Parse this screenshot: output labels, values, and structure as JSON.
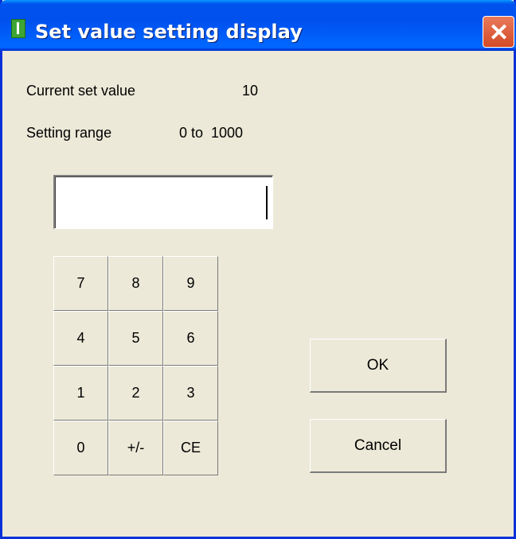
{
  "window": {
    "title": "Set value setting display"
  },
  "info": {
    "current_label": "Current set value",
    "current_value": "10",
    "range_label": "Setting range",
    "range_value": "0 to  1000"
  },
  "input": {
    "value": ""
  },
  "keypad": {
    "keys": [
      "7",
      "8",
      "9",
      "4",
      "5",
      "6",
      "1",
      "2",
      "3",
      "0",
      "+/-",
      "CE"
    ]
  },
  "actions": {
    "ok_label": "OK",
    "cancel_label": "Cancel"
  },
  "colors": {
    "titlebar": "#0050ee",
    "dialog_bg": "#ece9d8",
    "close_button": "#d34a25"
  },
  "icons": {
    "app": "thermometer-icon",
    "close": "close-icon"
  }
}
